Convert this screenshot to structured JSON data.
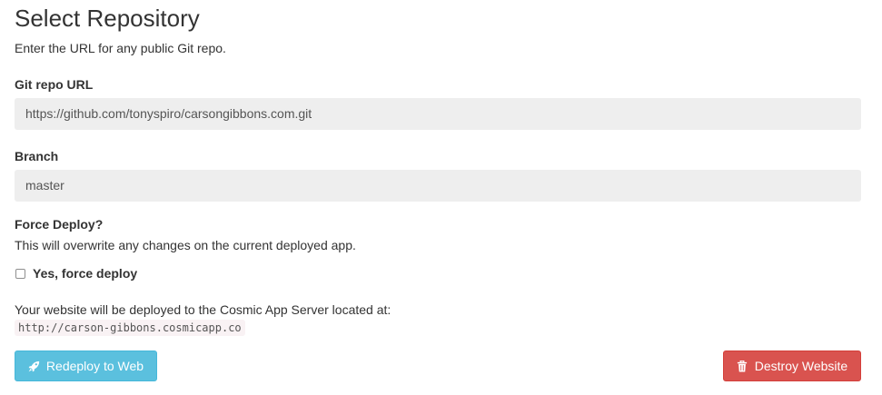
{
  "header": {
    "title": "Select Repository",
    "subtitle": "Enter the URL for any public Git repo."
  },
  "repo_url": {
    "label": "Git repo URL",
    "value": "https://github.com/tonyspiro/carsongibbons.com.git"
  },
  "branch": {
    "label": "Branch",
    "value": "master"
  },
  "force_deploy": {
    "label": "Force Deploy?",
    "description": "This will overwrite any changes on the current deployed app.",
    "checkbox_label": "Yes, force deploy",
    "checked": false
  },
  "deploy_info": {
    "text": "Your website will be deployed to the Cosmic App Server located at:",
    "url": "http://carson-gibbons.cosmicapp.co"
  },
  "actions": {
    "redeploy_label": "Redeploy to Web",
    "redeploy_icon": "rocket-icon",
    "destroy_label": "Destroy Website",
    "destroy_icon": "trash-icon"
  },
  "colors": {
    "primary": "#5bc0de",
    "danger": "#d9534f",
    "input_bg": "#eeeeee",
    "code_bg": "#f9f2f4"
  }
}
